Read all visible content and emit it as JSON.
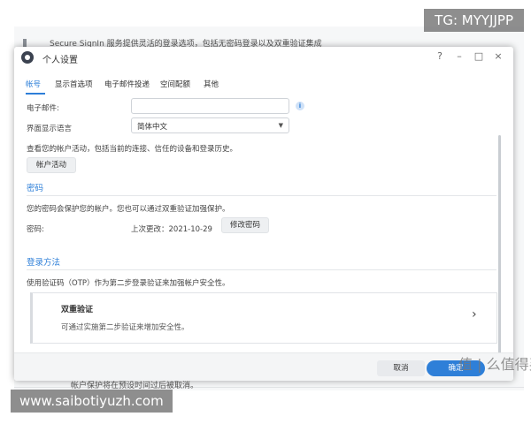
{
  "background": {
    "text_top": "Secure SignIn 服务提供灵活的登录选项，包括无密码登录以及双重验证集成",
    "text_bottom": "帐户保护将在预设时间过后被取消。"
  },
  "watermarks": {
    "top_right": "TG: MYYJJPP",
    "bottom_left": "www.saibotiyuzh.com",
    "brand": "值 | 么值得买"
  },
  "dialog": {
    "title": "个人设置",
    "controls": {
      "help": "?",
      "minimize": "–",
      "maximize": "□",
      "close": "×"
    },
    "tabs": [
      {
        "label": "帐号",
        "active": true
      },
      {
        "label": "显示首选项",
        "active": false
      },
      {
        "label": "电子邮件投递",
        "active": false
      },
      {
        "label": "空间配额",
        "active": false
      },
      {
        "label": "其他",
        "active": false
      }
    ],
    "account": {
      "email_label": "电子邮件:",
      "email_value": "",
      "language_label": "界面显示语言",
      "language_value": "简体中文",
      "activity_desc": "查看您的帐户活动，包括当前的连接、信任的设备和登录历史。",
      "activity_button": "帐户活动"
    },
    "password_section": {
      "title": "密码",
      "desc": "您的密码会保护您的帐户。您也可以通过双重验证加强保护。",
      "label": "密码:",
      "last_changed": "上次更改：2021-10-29",
      "change_button": "修改密码"
    },
    "login_section": {
      "title": "登录方法",
      "desc": "使用验证码（OTP）作为第二步登录验证来加强帐户安全性。",
      "two_factor_title": "双重验证",
      "two_factor_desc": "可通过实施第二步验证来增加安全性。"
    },
    "footer": {
      "cancel": "取消",
      "ok": "确定"
    }
  },
  "colors": {
    "accent": "#2e7fd8",
    "text": "#333333"
  },
  "icons": {
    "app": "settings-app-icon",
    "info": "info-icon",
    "dropdown": "chevron-down-icon",
    "card_arrow": "chevron-right-icon"
  }
}
